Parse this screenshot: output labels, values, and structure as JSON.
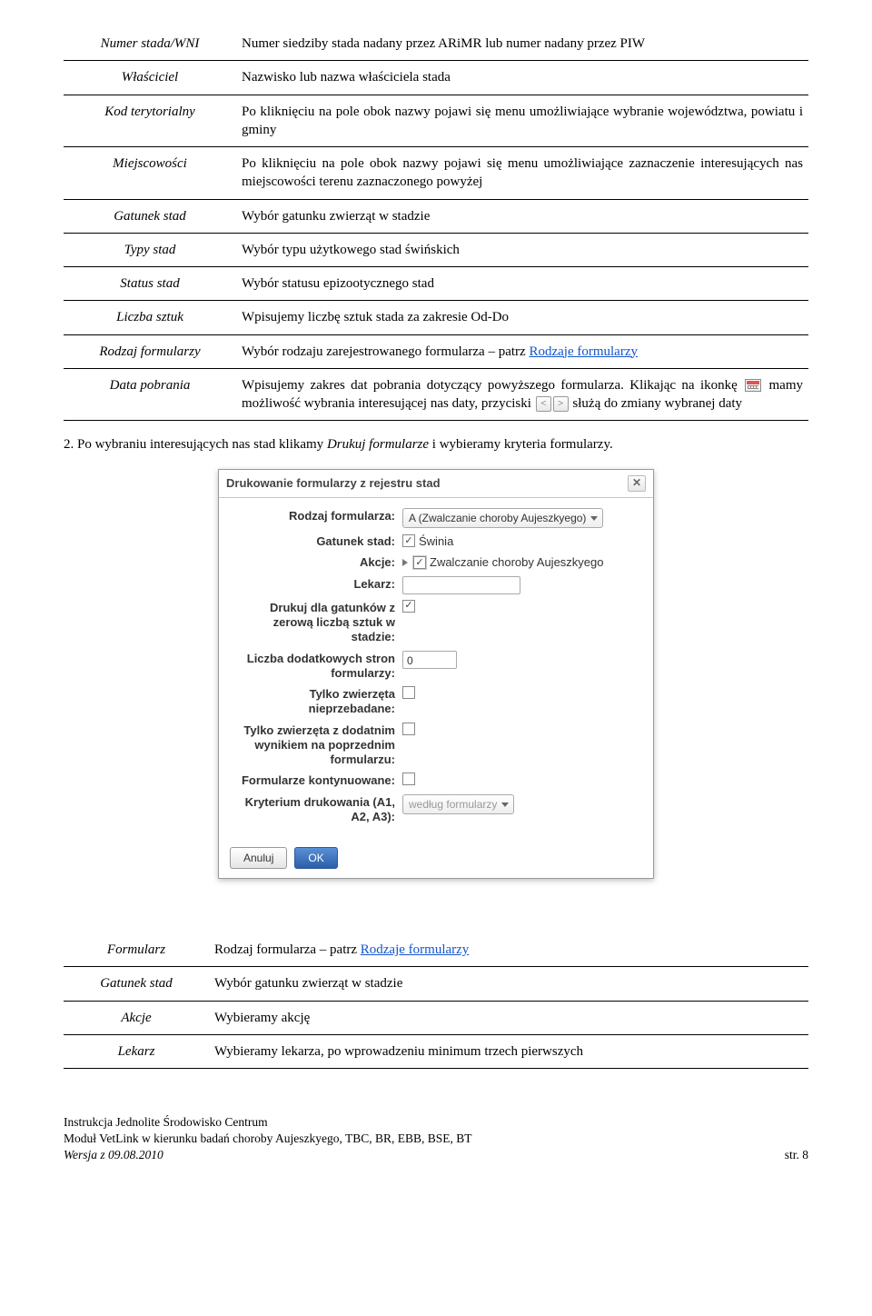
{
  "table1": {
    "rows": [
      {
        "term": "Numer stada/WNI",
        "desc": "Numer siedziby stada nadany przez ARiMR lub numer nadany przez PIW"
      },
      {
        "term": "Właściciel",
        "desc": "Nazwisko lub nazwa właściciela stada"
      },
      {
        "term": "Kod terytorialny",
        "desc": "Po kliknięciu na pole obok nazwy pojawi się menu umożliwiające wybranie województwa, powiatu i gminy"
      },
      {
        "term": "Miejscowości",
        "desc": "Po kliknięciu na pole obok nazwy pojawi się menu umożliwiające zaznaczenie interesujących nas miejscowości terenu zaznaczonego powyżej"
      },
      {
        "term": "Gatunek stad",
        "desc": "Wybór gatunku zwierząt w stadzie"
      },
      {
        "term": "Typy stad",
        "desc": "Wybór typu użytkowego stad świńskich"
      },
      {
        "term": "Status stad",
        "desc": "Wybór statusu epizootycznego stad"
      },
      {
        "term": "Liczba sztuk",
        "desc": "Wpisujemy liczbę sztuk stada za zakresie Od-Do"
      }
    ],
    "rodzaj": {
      "term": "Rodzaj formularzy",
      "pre": "Wybór rodzaju zarejestrowanego formularza – patrz ",
      "link": "Rodzaje formularzy"
    },
    "data_pobrania": {
      "term": "Data pobrania",
      "line1": "Wpisujemy zakres dat pobrania dotyczący powyższego formularza. Klikając na ikonkę ",
      "mid": " mamy możliwość wybrania interesującej nas daty, przyciski ",
      "tail": " służą do zmiany wybranej daty"
    }
  },
  "num_item": {
    "pre": "2. Po wybraniu interesujących nas stad klikamy ",
    "italic": "Drukuj formularze",
    "post": " i wybieramy kryteria formularzy."
  },
  "dialog": {
    "title": "Drukowanie formularzy z rejestru stad",
    "labels": {
      "rodzaj": "Rodzaj formularza:",
      "gatunek": "Gatunek stad:",
      "akcje": "Akcje:",
      "lekarz": "Lekarz:",
      "zerowa": "Drukuj dla gatunków z zerową liczbą sztuk w stadzie:",
      "stron": "Liczba dodatkowych stron formularzy:",
      "nieprzebadane": "Tylko zwierzęta nieprzebadane:",
      "dodatnim": "Tylko zwierzęta z dodatnim wynikiem na poprzednim formularzu:",
      "kontynuowane": "Formularze kontynuowane:",
      "kryterium": "Kryterium drukowania (A1, A2, A3):"
    },
    "values": {
      "rodzaj": "A   (Zwalczanie choroby Aujeszkyego)",
      "gatunek": "Świnia",
      "akcje": "Zwalczanie choroby Aujeszkyego",
      "stron": "0",
      "kryterium": "według formularzy"
    },
    "buttons": {
      "cancel": "Anuluj",
      "ok": "OK"
    }
  },
  "table2": {
    "formularz": {
      "term": "Formularz",
      "pre": "Rodzaj formularza – patrz ",
      "link": "Rodzaje formularzy"
    },
    "gatunek": {
      "term": "Gatunek stad",
      "desc": "Wybór gatunku zwierząt w stadzie"
    },
    "akcje": {
      "term": "Akcje",
      "desc": "Wybieramy akcję"
    },
    "lekarz": {
      "term": "Lekarz",
      "desc": "Wybieramy lekarza, po wprowadzeniu minimum trzech pierwszych"
    }
  },
  "footer": {
    "l1": "Instrukcja Jednolite Środowisko Centrum",
    "l2": "Moduł VetLink w kierunku badań choroby Aujeszkyego, TBC, BR, EBB, BSE, BT",
    "version_label": "Wersja z 09.08.2010",
    "page": "str. 8"
  }
}
